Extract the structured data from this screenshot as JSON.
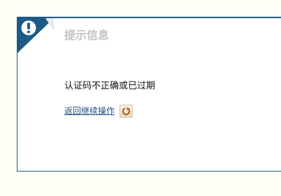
{
  "dialog": {
    "title": "提示信息",
    "message": "认证码不正确或已过期",
    "return_link": "返回继续操作",
    "badge_icon": "exclamation-icon",
    "refresh_icon": "refresh-icon"
  },
  "colors": {
    "border": "#1d5b86",
    "badge": "#1d5b86",
    "title": "#c2c2c2",
    "link": "#1e4f82",
    "refresh_arrow": "#b5541c",
    "page_background": "#fffff8"
  }
}
